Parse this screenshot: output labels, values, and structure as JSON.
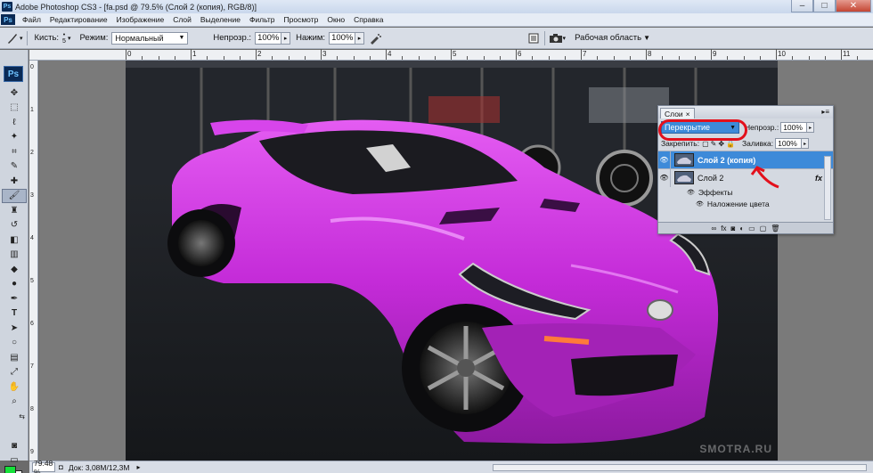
{
  "window": {
    "app_title": "Adobe Photoshop CS3 - [fa.psd @ 79.5% (Слой 2 (копия), RGB/8)]",
    "minimize": "–",
    "maximize": "□",
    "close": "✕"
  },
  "menu": {
    "items": [
      "Файл",
      "Редактирование",
      "Изображение",
      "Слой",
      "Выделение",
      "Фильтр",
      "Просмотр",
      "Окно",
      "Справка"
    ]
  },
  "options": {
    "brush_label": "Кисть:",
    "brush_size": "5",
    "mode_label": "Режим:",
    "mode_value": "Нормальный",
    "opacity_label": "Непрозр.:",
    "opacity_value": "100%",
    "pressure_label": "Нажим:",
    "pressure_value": "100%",
    "workspace_label": "Рабочая область"
  },
  "rulers": {
    "h_labels": [
      "0",
      "1",
      "2",
      "3",
      "4",
      "5",
      "6",
      "7",
      "8",
      "9",
      "10",
      "11"
    ],
    "v_labels": [
      "0",
      "1",
      "2",
      "3",
      "4",
      "5",
      "6",
      "7",
      "8",
      "9"
    ]
  },
  "layers_panel": {
    "tab_label": "Слои",
    "tab_close": "×",
    "blend_mode": "Перекрытие",
    "opacity_label": "Непрозр.:",
    "opacity_value": "100%",
    "lock_label": "Закрепить:",
    "fill_label": "Заливка:",
    "fill_value": "100%",
    "layers": [
      {
        "name": "Слой 2 (копия)",
        "selected": true
      },
      {
        "name": "Слой 2",
        "selected": false,
        "fx": "fx"
      }
    ],
    "effects_label": "Эффекты",
    "effect_item": "Наложение цвета"
  },
  "status": {
    "zoom": "79.48 %",
    "doc_info": "Док: 3,08M/12,3M"
  },
  "watermark": "SMOTRA.RU",
  "colors": {
    "foreground": "#16e13a",
    "background": "#ffffff",
    "car_body": "#c42bd8",
    "highlight_circle": "#e3101c",
    "selection": "#3d8ad9"
  }
}
